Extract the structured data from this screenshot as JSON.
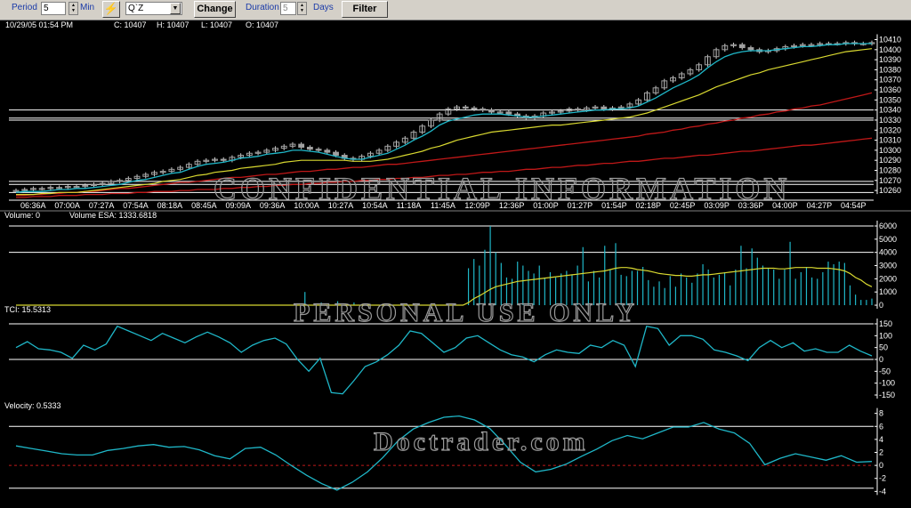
{
  "toolbar": {
    "period_label": "Period",
    "period_value": "5",
    "min_label": "Min",
    "symbol_value": "Q`Z",
    "change_label": "Change",
    "duration_label": "Duration",
    "duration_value": "5",
    "days_label": "Days",
    "filter_label": "Filter"
  },
  "header": {
    "datetime": "10/29/05 01:54 PM",
    "close": "C: 10407",
    "high": "H: 10407",
    "low": "L: 10407",
    "open": "O: 10407"
  },
  "watermarks": {
    "price": "CONFIDENTIAL INFORMATION",
    "volume": "PERSONAL USE ONLY",
    "velocity": "Doctrader.com"
  },
  "colors": {
    "background": "#000000",
    "candle_body": "#a0a0a0",
    "cyan": "#1fb7c8",
    "yellow": "#d8d830",
    "red": "#c01818",
    "guide": "#ffffff",
    "zero_line": "#c01818"
  },
  "chart_data": [
    {
      "type": "candlestick",
      "panel": "price",
      "x_ticks": [
        "06:36A",
        "07:00A",
        "07:27A",
        "07:54A",
        "08:18A",
        "08:45A",
        "09:09A",
        "09:36A",
        "10:00A",
        "10:27A",
        "10:54A",
        "11:18A",
        "11:45A",
        "12:09P",
        "12:36P",
        "01:00P",
        "01:27P",
        "01:54P",
        "02:18P",
        "02:45P",
        "03:09P",
        "03:36P",
        "04:00P",
        "04:27P",
        "04:54P"
      ],
      "y_ticks": [
        10410,
        10400,
        10390,
        10380,
        10370,
        10360,
        10350,
        10340,
        10330,
        10320,
        10310,
        10300,
        10290,
        10280,
        10270,
        10260
      ],
      "ylim": [
        10253,
        10414
      ],
      "closes": [
        10260,
        10261,
        10262,
        10262,
        10263,
        10263,
        10264,
        10264,
        10265,
        10266,
        10267,
        10269,
        10270,
        10272,
        10274,
        10276,
        10278,
        10279,
        10281,
        10283,
        10286,
        10289,
        10290,
        10291,
        10290,
        10293,
        10295,
        10297,
        10298,
        10300,
        10302,
        10304,
        10306,
        10303,
        10301,
        10300,
        10298,
        10295,
        10292,
        10291,
        10294,
        10297,
        10300,
        10304,
        10308,
        10312,
        10318,
        10324,
        10330,
        10336,
        10341,
        10343,
        10342,
        10341,
        10340,
        10338,
        10338,
        10336,
        10334,
        10332,
        10334,
        10337,
        10338,
        10339,
        10341,
        10340,
        10342,
        10343,
        10341,
        10342,
        10343,
        10346,
        10350,
        10357,
        10362,
        10369,
        10372,
        10376,
        10380,
        10385,
        10393,
        10400,
        10404,
        10405,
        10402,
        10400,
        10398,
        10399,
        10401,
        10403,
        10404,
        10405,
        10405,
        10406,
        10406,
        10406,
        10407,
        10406,
        10406,
        10407
      ],
      "cyan_ma": [
        10258,
        10259,
        10259,
        10259,
        10260,
        10261,
        10261,
        10262,
        10262,
        10263,
        10264,
        10265,
        10266,
        10268,
        10270,
        10271,
        10273,
        10275,
        10277,
        10278,
        10281,
        10284,
        10286,
        10287,
        10288,
        10290,
        10292,
        10293,
        10294,
        10296,
        10297,
        10298,
        10300,
        10300,
        10299,
        10298,
        10296,
        10294,
        10292,
        10291,
        10291,
        10293,
        10295,
        10297,
        10301,
        10305,
        10310,
        10314,
        10319,
        10325,
        10329,
        10331,
        10333,
        10335,
        10336,
        10336,
        10336,
        10335,
        10334,
        10333,
        10333,
        10334,
        10335,
        10336,
        10337,
        10338,
        10339,
        10340,
        10340,
        10341,
        10341,
        10342,
        10344,
        10348,
        10352,
        10357,
        10362,
        10366,
        10370,
        10375,
        10382,
        10388,
        10393,
        10396,
        10398,
        10399,
        10399,
        10399,
        10400,
        10401,
        10402,
        10403,
        10403,
        10404,
        10405,
        10405,
        10406,
        10406,
        10406,
        10406
      ],
      "yellow_ma": [
        10256,
        10256,
        10256,
        10257,
        10257,
        10258,
        10258,
        10258,
        10259,
        10260,
        10261,
        10262,
        10263,
        10264,
        10265,
        10266,
        10267,
        10269,
        10270,
        10271,
        10273,
        10275,
        10276,
        10278,
        10279,
        10280,
        10282,
        10283,
        10284,
        10285,
        10286,
        10288,
        10289,
        10290,
        10290,
        10290,
        10290,
        10290,
        10290,
        10289,
        10289,
        10289,
        10290,
        10291,
        10293,
        10295,
        10297,
        10299,
        10302,
        10304,
        10307,
        10310,
        10312,
        10314,
        10316,
        10318,
        10319,
        10320,
        10321,
        10322,
        10323,
        10324,
        10325,
        10325,
        10326,
        10327,
        10328,
        10329,
        10330,
        10331,
        10332,
        10333,
        10335,
        10337,
        10340,
        10343,
        10346,
        10349,
        10352,
        10355,
        10359,
        10363,
        10366,
        10369,
        10372,
        10375,
        10377,
        10380,
        10382,
        10384,
        10386,
        10388,
        10390,
        10392,
        10394,
        10396,
        10398,
        10399,
        10400,
        10401
      ],
      "red_ma_fast": [
        10255,
        10255,
        10256,
        10256,
        10257,
        10257,
        10258,
        10258,
        10259,
        10259,
        10260,
        10261,
        10262,
        10262,
        10263,
        10264,
        10265,
        10266,
        10267,
        10268,
        10268,
        10269,
        10270,
        10271,
        10272,
        10273,
        10273,
        10274,
        10275,
        10276,
        10276,
        10277,
        10278,
        10279,
        10279,
        10280,
        10281,
        10281,
        10282,
        10283,
        10283,
        10284,
        10285,
        10286,
        10286,
        10287,
        10288,
        10289,
        10290,
        10291,
        10292,
        10293,
        10294,
        10295,
        10296,
        10297,
        10298,
        10299,
        10300,
        10301,
        10302,
        10303,
        10304,
        10305,
        10306,
        10307,
        10308,
        10309,
        10310,
        10311,
        10312,
        10313,
        10314,
        10316,
        10317,
        10318,
        10320,
        10321,
        10323,
        10324,
        10326,
        10327,
        10329,
        10330,
        10332,
        10333,
        10335,
        10336,
        10338,
        10339,
        10341,
        10342,
        10344,
        10345,
        10347,
        10349,
        10351,
        10353,
        10355,
        10357
      ],
      "red_ma_slow": [
        10253,
        10253,
        10254,
        10254,
        10254,
        10255,
        10255,
        10255,
        10256,
        10256,
        10256,
        10257,
        10257,
        10257,
        10258,
        10258,
        10259,
        10259,
        10259,
        10260,
        10260,
        10261,
        10261,
        10261,
        10262,
        10262,
        10263,
        10263,
        10264,
        10264,
        10265,
        10265,
        10266,
        10266,
        10267,
        10267,
        10268,
        10268,
        10269,
        10269,
        10270,
        10270,
        10271,
        10271,
        10272,
        10272,
        10273,
        10273,
        10274,
        10275,
        10275,
        10276,
        10276,
        10277,
        10278,
        10278,
        10279,
        10279,
        10280,
        10281,
        10281,
        10282,
        10283,
        10283,
        10284,
        10285,
        10285,
        10286,
        10287,
        10287,
        10288,
        10289,
        10289,
        10290,
        10291,
        10292,
        10292,
        10293,
        10294,
        10295,
        10295,
        10296,
        10297,
        10298,
        10299,
        10299,
        10300,
        10301,
        10302,
        10303,
        10304,
        10305,
        10305,
        10306,
        10307,
        10308,
        10309,
        10310,
        10311,
        10312
      ],
      "guide_levels": [
        10340,
        10332,
        10330,
        10269,
        10266,
        10258
      ]
    },
    {
      "type": "bar",
      "panel": "volume",
      "label": "Volume: 0",
      "esa_label": "Volume ESA: 1333.6818",
      "y_ticks": [
        6000,
        5000,
        4000,
        3000,
        2000,
        1000,
        0
      ],
      "ylim": [
        -200,
        6000
      ],
      "guide_levels": [
        6000,
        4000
      ],
      "values": [
        0,
        0,
        0,
        0,
        0,
        0,
        0,
        0,
        0,
        0,
        0,
        0,
        0,
        0,
        0,
        0,
        0,
        0,
        0,
        0,
        0,
        0,
        0,
        0,
        0,
        0,
        0,
        0,
        0,
        0,
        0,
        0,
        0,
        0,
        0,
        0,
        0,
        0,
        0,
        0,
        0,
        0,
        0,
        0,
        0,
        0,
        0,
        0,
        0,
        0,
        0,
        0,
        0,
        1000,
        0,
        0,
        200,
        0,
        0,
        300,
        0,
        0,
        200,
        0,
        0,
        0,
        0,
        0,
        0,
        0,
        0,
        0,
        0,
        0,
        0,
        0,
        0,
        0,
        0,
        0,
        0,
        0,
        0,
        2800,
        3500,
        3000,
        4200,
        6000,
        4000,
        3200,
        2100,
        2000,
        3300,
        3000,
        2600,
        2400,
        3000,
        2100,
        2500,
        2100,
        2400,
        2600,
        2300,
        3000,
        4400,
        1800,
        2600,
        2100,
        4500,
        2700,
        4700,
        2300,
        2200,
        2600,
        2600,
        2900,
        1900,
        1400,
        1800,
        1300,
        2200,
        1400,
        2400,
        2100,
        1700,
        2400,
        3100,
        2700,
        2100,
        2300,
        2500,
        1500,
        2700,
        4500,
        2800,
        4300,
        3600,
        3000,
        2800,
        2700,
        2000,
        2700,
        4800,
        2000,
        2500,
        2900,
        2100,
        2000,
        2500,
        3300,
        3100,
        3300,
        3200,
        1500,
        800,
        400,
        400,
        500
      ],
      "esa": [
        0,
        0,
        0,
        0,
        0,
        0,
        0,
        0,
        0,
        0,
        0,
        0,
        0,
        0,
        0,
        0,
        0,
        0,
        0,
        0,
        0,
        0,
        0,
        0,
        0,
        0,
        0,
        0,
        0,
        0,
        0,
        0,
        0,
        0,
        0,
        0,
        0,
        0,
        0,
        0,
        0,
        0,
        0,
        0,
        0,
        0,
        0,
        0,
        0,
        0,
        0,
        0,
        0,
        0,
        0,
        0,
        0,
        0,
        0,
        0,
        0,
        0,
        0,
        0,
        0,
        0,
        0,
        0,
        0,
        0,
        0,
        0,
        0,
        0,
        0,
        0,
        0,
        0,
        0,
        0,
        0,
        0,
        0,
        200,
        500,
        700,
        950,
        1200,
        1400,
        1500,
        1600,
        1700,
        1800,
        1850,
        1900,
        1950,
        2000,
        2050,
        2100,
        2150,
        2200,
        2250,
        2300,
        2350,
        2400,
        2450,
        2500,
        2550,
        2600,
        2700,
        2800,
        2850,
        2850,
        2800,
        2700,
        2650,
        2600,
        2500,
        2400,
        2350,
        2300,
        2250,
        2250,
        2200,
        2200,
        2250,
        2300,
        2300,
        2350,
        2400,
        2450,
        2500,
        2550,
        2600,
        2650,
        2700,
        2750,
        2800,
        2800,
        2800,
        2750,
        2750,
        2800,
        2850,
        2850,
        2850,
        2850,
        2800,
        2800,
        2800,
        2750,
        2700,
        2600,
        2400,
        2100,
        1900,
        1600,
        1400
      ],
      "exact_esa_from_bars": false
    },
    {
      "type": "line",
      "panel": "tci",
      "label": "TCI: 15.5313",
      "y_ticks": [
        150,
        100,
        50,
        0,
        -50,
        -100,
        -150
      ],
      "ylim": [
        -150,
        150
      ],
      "guide_levels": [
        150,
        0
      ],
      "values": [
        50,
        75,
        45,
        40,
        30,
        5,
        60,
        40,
        65,
        140,
        120,
        100,
        80,
        110,
        90,
        70,
        95,
        115,
        95,
        70,
        30,
        60,
        80,
        90,
        65,
        0,
        -50,
        5,
        -140,
        -145,
        -90,
        -30,
        -10,
        20,
        60,
        120,
        110,
        70,
        30,
        50,
        90,
        100,
        70,
        40,
        20,
        10,
        -10,
        20,
        40,
        30,
        25,
        60,
        50,
        80,
        60,
        -30,
        140,
        130,
        60,
        100,
        100,
        85,
        40,
        30,
        15,
        -5,
        50,
        80,
        50,
        70,
        35,
        45,
        30,
        30,
        60,
        35,
        15
      ]
    },
    {
      "type": "line",
      "panel": "velocity",
      "label": "Velocity: 0.5333",
      "y_ticks": [
        8,
        6,
        4,
        2,
        0,
        -2,
        -4
      ],
      "ylim": [
        -4.5,
        8.5
      ],
      "guide_levels": [
        6,
        -3.5
      ],
      "zero_line": 0,
      "values": [
        3,
        2.6,
        2.2,
        1.8,
        1.6,
        1.6,
        2.3,
        2.6,
        3.0,
        3.2,
        2.8,
        2.9,
        2.4,
        1.5,
        1.0,
        2.6,
        2.8,
        1.6,
        0.0,
        -1.5,
        -2.8,
        -3.8,
        -2.6,
        -1.0,
        1.2,
        3.8,
        5.6,
        6.6,
        7.4,
        7.6,
        7.0,
        5.7,
        3.2,
        0.5,
        -1.0,
        -0.6,
        0.2,
        1.4,
        2.5,
        3.8,
        4.6,
        4.1,
        5.0,
        5.9,
        5.9,
        6.6,
        5.6,
        5.0,
        3.4,
        0.1,
        1.1,
        1.8,
        1.3,
        0.8,
        1.5,
        0.5,
        0.6
      ]
    }
  ]
}
